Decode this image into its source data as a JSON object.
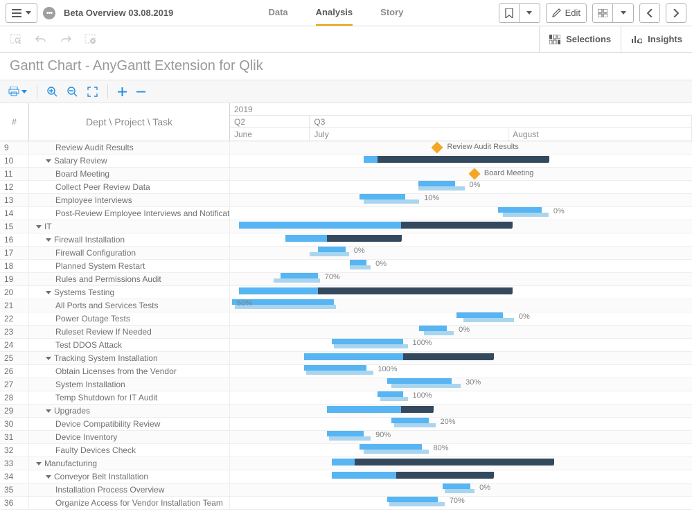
{
  "header": {
    "appTitle": "Beta Overview 03.08.2019",
    "tabs": {
      "data": "Data",
      "analysis": "Analysis",
      "story": "Story"
    },
    "editLabel": "Edit"
  },
  "toolbar2": {
    "selectionsLabel": "Selections",
    "insightsLabel": "Insights"
  },
  "sheetTitle": "Gantt Chart - AnyGantt Extension for Qlik",
  "ganttHeader": {
    "numCol": "#",
    "taskCol": "Dept \\ Project \\ Task",
    "year": "2019",
    "quarters": [
      {
        "label": "Q2",
        "widthPct": 17.3
      },
      {
        "label": "Q3",
        "widthPct": 82.7
      }
    ],
    "months": [
      {
        "label": "June",
        "widthPct": 17.3
      },
      {
        "label": "July",
        "widthPct": 43.0
      },
      {
        "label": "August",
        "widthPct": 39.7
      }
    ]
  },
  "chart_data": {
    "type": "gantt",
    "time_axis": {
      "year": 2019,
      "start": "2019-06-01",
      "end": "2019-09-01",
      "quarters": [
        "Q2",
        "Q3"
      ],
      "months": [
        "June",
        "July",
        "August"
      ]
    },
    "rows": [
      {
        "num": 9,
        "indent": 2,
        "task": "Review Audit Results",
        "milestone": {
          "xPct": 44.0,
          "label": "Review Audit Results"
        }
      },
      {
        "num": 10,
        "indent": 1,
        "task": "Salary Review",
        "expandable": true,
        "summary": {
          "leftPct": 29.0,
          "widthPct": 40.0,
          "darkLeftPct": 32.0,
          "darkWidthPct": 37.0
        }
      },
      {
        "num": 11,
        "indent": 2,
        "task": "Board Meeting",
        "milestone": {
          "xPct": 52.0,
          "label": "Board Meeting"
        }
      },
      {
        "num": 12,
        "indent": 2,
        "task": "Collect Peer Review Data",
        "bar": {
          "leftPct": 40.8,
          "widthPct": 8.0,
          "baseLeftPct": 40.8,
          "baseWidthPct": 10.0,
          "pct": "0%"
        }
      },
      {
        "num": 13,
        "indent": 2,
        "task": "Employee Interviews",
        "bar": {
          "leftPct": 28.0,
          "widthPct": 10.0,
          "baseLeftPct": 29.0,
          "baseWidthPct": 12.0,
          "pct": "10%"
        }
      },
      {
        "num": 14,
        "indent": 2,
        "task": "Post-Review Employee Interviews and Notifications",
        "bar": {
          "leftPct": 58.0,
          "widthPct": 9.5,
          "baseLeftPct": 59.0,
          "baseWidthPct": 10.0,
          "pct": "0%"
        }
      },
      {
        "num": 15,
        "indent": 0,
        "task": "IT",
        "expandable": true,
        "summary": {
          "leftPct": 2.0,
          "widthPct": 59.0,
          "darkLeftPct": 37.0,
          "darkWidthPct": 24.0
        }
      },
      {
        "num": 16,
        "indent": 1,
        "task": "Firewall Installation",
        "expandable": true,
        "summary": {
          "leftPct": 12.0,
          "widthPct": 25.0,
          "darkLeftPct": 21.0,
          "darkWidthPct": 16.0
        }
      },
      {
        "num": 17,
        "indent": 2,
        "task": "Firewall Configuration",
        "bar": {
          "leftPct": 19.0,
          "widthPct": 6.0,
          "baseLeftPct": 17.3,
          "baseWidthPct": 8.5,
          "pct": "0%"
        }
      },
      {
        "num": 18,
        "indent": 2,
        "task": "Planned System Restart",
        "bar": {
          "leftPct": 26.0,
          "widthPct": 3.5,
          "baseLeftPct": 26.0,
          "baseWidthPct": 4.5,
          "pct": "0%"
        }
      },
      {
        "num": 19,
        "indent": 2,
        "task": "Rules and Permissions Audit",
        "bar": {
          "leftPct": 11.0,
          "widthPct": 8.0,
          "baseLeftPct": 9.5,
          "baseWidthPct": 10.0,
          "pct": "70%"
        }
      },
      {
        "num": 20,
        "indent": 1,
        "task": "Systems Testing",
        "expandable": true,
        "summary": {
          "leftPct": 2.0,
          "widthPct": 59.0,
          "darkLeftPct": 19.0,
          "darkWidthPct": 42.0
        }
      },
      {
        "num": 21,
        "indent": 2,
        "task": "All Ports and Services Tests",
        "bar": {
          "leftPct": 0.5,
          "widthPct": 22.0,
          "baseLeftPct": 1.0,
          "baseWidthPct": 22.0,
          "pct": "50%",
          "pctLeft": true
        }
      },
      {
        "num": 22,
        "indent": 2,
        "task": "Power Outage Tests",
        "bar": {
          "leftPct": 49.0,
          "widthPct": 10.0,
          "baseLeftPct": 50.5,
          "baseWidthPct": 11.0,
          "pct": "0%"
        }
      },
      {
        "num": 23,
        "indent": 2,
        "task": "Ruleset Review If Needed",
        "bar": {
          "leftPct": 41.0,
          "widthPct": 6.0,
          "baseLeftPct": 42.0,
          "baseWidthPct": 6.5,
          "pct": "0%"
        }
      },
      {
        "num": 24,
        "indent": 2,
        "task": "Test DDOS Attack",
        "bar": {
          "leftPct": 22.0,
          "widthPct": 15.5,
          "baseLeftPct": 22.5,
          "baseWidthPct": 16.0,
          "pct": "100%"
        }
      },
      {
        "num": 25,
        "indent": 1,
        "task": "Tracking System Installation",
        "expandable": true,
        "summary": {
          "leftPct": 16.0,
          "widthPct": 41.0,
          "darkLeftPct": 37.5,
          "darkWidthPct": 19.5
        }
      },
      {
        "num": 26,
        "indent": 2,
        "task": "Obtain Licenses from the Vendor",
        "bar": {
          "leftPct": 16.0,
          "widthPct": 13.5,
          "baseLeftPct": 16.5,
          "baseWidthPct": 14.5,
          "pct": "100%"
        }
      },
      {
        "num": 27,
        "indent": 2,
        "task": "System Installation",
        "bar": {
          "leftPct": 34.0,
          "widthPct": 14.0,
          "baseLeftPct": 35.0,
          "baseWidthPct": 15.0,
          "pct": "30%"
        }
      },
      {
        "num": 28,
        "indent": 2,
        "task": "Temp Shutdown for IT Audit",
        "bar": {
          "leftPct": 32.0,
          "widthPct": 5.5,
          "baseLeftPct": 32.5,
          "baseWidthPct": 6.0,
          "pct": "100%"
        }
      },
      {
        "num": 29,
        "indent": 1,
        "task": "Upgrades",
        "expandable": true,
        "summary": {
          "leftPct": 21.0,
          "widthPct": 23.0,
          "darkLeftPct": 37.0,
          "darkWidthPct": 7.0
        }
      },
      {
        "num": 30,
        "indent": 2,
        "task": "Device Compatibility Review",
        "bar": {
          "leftPct": 35.0,
          "widthPct": 8.0,
          "baseLeftPct": 35.5,
          "baseWidthPct": 9.0,
          "pct": "20%"
        }
      },
      {
        "num": 31,
        "indent": 2,
        "task": "Device Inventory",
        "bar": {
          "leftPct": 21.0,
          "widthPct": 8.0,
          "baseLeftPct": 21.5,
          "baseWidthPct": 9.0,
          "pct": "90%"
        }
      },
      {
        "num": 32,
        "indent": 2,
        "task": "Faulty Devices Check",
        "bar": {
          "leftPct": 28.0,
          "widthPct": 13.5,
          "baseLeftPct": 29.0,
          "baseWidthPct": 14.0,
          "pct": "80%"
        }
      },
      {
        "num": 33,
        "indent": 0,
        "task": "Manufacturing",
        "expandable": true,
        "summary": {
          "leftPct": 22.0,
          "widthPct": 48.0,
          "darkLeftPct": 27.0,
          "darkWidthPct": 43.0
        }
      },
      {
        "num": 34,
        "indent": 1,
        "task": "Conveyor Belt Installation",
        "expandable": true,
        "summary": {
          "leftPct": 22.0,
          "widthPct": 35.0,
          "darkLeftPct": 36.0,
          "darkWidthPct": 21.0
        }
      },
      {
        "num": 35,
        "indent": 2,
        "task": "Installation Process Overview",
        "bar": {
          "leftPct": 46.0,
          "widthPct": 6.0,
          "baseLeftPct": 46.5,
          "baseWidthPct": 6.5,
          "pct": "0%"
        }
      },
      {
        "num": 36,
        "indent": 2,
        "task": "Organize Access for Vendor Installation Team",
        "bar": {
          "leftPct": 34.0,
          "widthPct": 11.0,
          "baseLeftPct": 34.5,
          "baseWidthPct": 12.0,
          "pct": "70%"
        }
      }
    ]
  }
}
